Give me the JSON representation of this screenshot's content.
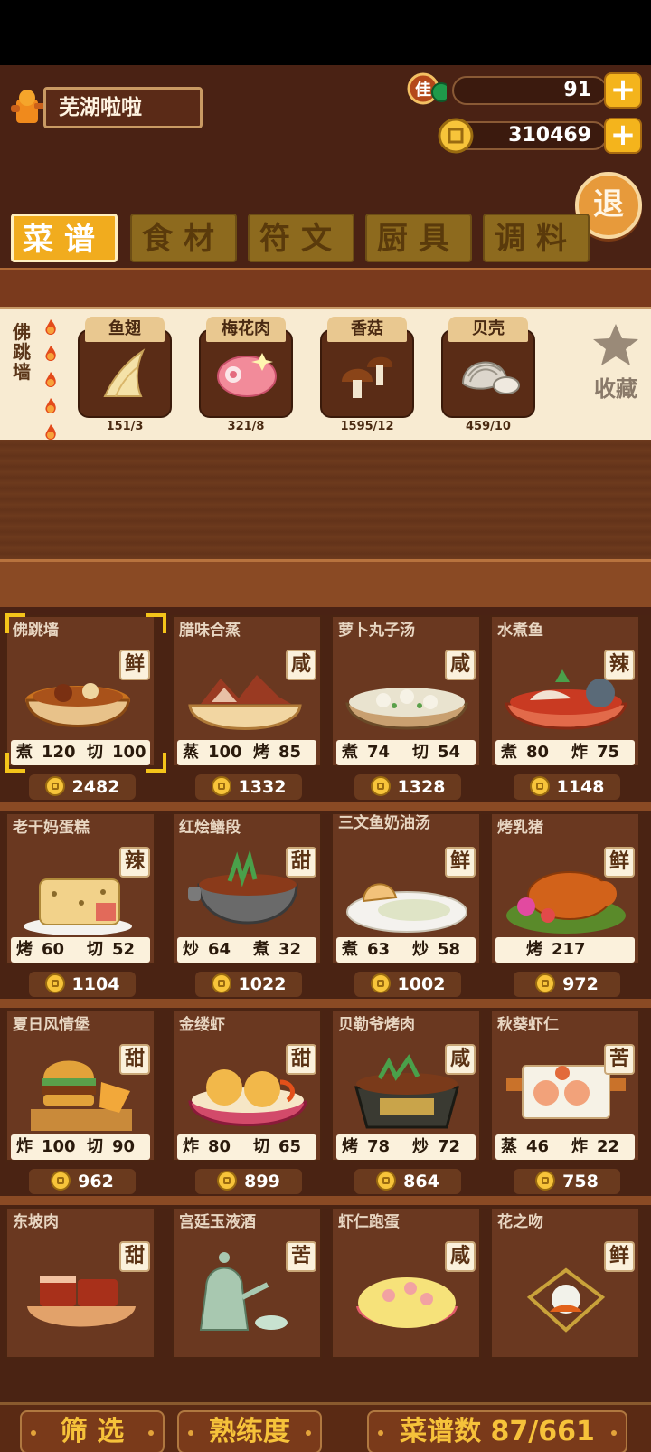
{
  "player": {
    "name": "芜湖啦啦"
  },
  "currencies": [
    {
      "icon": "jade-icon",
      "badge": "佳",
      "value": "91"
    },
    {
      "icon": "coin-icon",
      "value": "310469"
    }
  ],
  "exit_label": "退",
  "tabs": [
    {
      "label": "菜谱",
      "active": true
    },
    {
      "label": "食材",
      "active": false
    },
    {
      "label": "符文",
      "active": false
    },
    {
      "label": "厨具",
      "active": false
    },
    {
      "label": "调料",
      "active": false
    }
  ],
  "selected_recipe": {
    "name": "佛跳墙",
    "stars": 5,
    "ingredients": [
      {
        "name": "鱼翅",
        "count": "151/3"
      },
      {
        "name": "梅花肉",
        "count": "321/8"
      },
      {
        "name": "香菇",
        "count": "1595/12"
      },
      {
        "name": "贝壳",
        "count": "459/10"
      }
    ],
    "favorite_label": "收藏"
  },
  "recipes": [
    {
      "name": "佛跳墙",
      "flavor": "鲜",
      "s1": "煮",
      "v1": "120",
      "s2": "切",
      "v2": "100",
      "price": "2482"
    },
    {
      "name": "腊味合蒸",
      "flavor": "咸",
      "s1": "蒸",
      "v1": "100",
      "s2": "烤",
      "v2": "85",
      "price": "1332"
    },
    {
      "name": "萝卜丸子汤",
      "flavor": "咸",
      "s1": "煮",
      "v1": "74",
      "s2": "切",
      "v2": "54",
      "price": "1328"
    },
    {
      "name": "水煮鱼",
      "flavor": "辣",
      "s1": "煮",
      "v1": "80",
      "s2": "炸",
      "v2": "75",
      "price": "1148"
    },
    {
      "name": "老干妈蛋糕",
      "flavor": "辣",
      "s1": "烤",
      "v1": "60",
      "s2": "切",
      "v2": "52",
      "price": "1104"
    },
    {
      "name": "红烩鳝段",
      "flavor": "甜",
      "s1": "炒",
      "v1": "64",
      "s2": "煮",
      "v2": "32",
      "price": "1022"
    },
    {
      "name": "三文鱼奶油汤",
      "flavor": "鲜",
      "s1": "煮",
      "v1": "63",
      "s2": "炒",
      "v2": "58",
      "price": "1002"
    },
    {
      "name": "烤乳猪",
      "flavor": "鲜",
      "s1": "烤",
      "v1": "217",
      "s2": "",
      "v2": "",
      "price": "972"
    },
    {
      "name": "夏日风情堡",
      "flavor": "甜",
      "s1": "炸",
      "v1": "100",
      "s2": "切",
      "v2": "90",
      "price": "962"
    },
    {
      "name": "金缕虾",
      "flavor": "甜",
      "s1": "炸",
      "v1": "80",
      "s2": "切",
      "v2": "65",
      "price": "899"
    },
    {
      "name": "贝勒爷烤肉",
      "flavor": "咸",
      "s1": "烤",
      "v1": "78",
      "s2": "炒",
      "v2": "72",
      "price": "864"
    },
    {
      "name": "秋葵虾仁",
      "flavor": "苦",
      "s1": "蒸",
      "v1": "46",
      "s2": "炸",
      "v2": "22",
      "price": "758"
    },
    {
      "name": "东坡肉",
      "flavor": "甜"
    },
    {
      "name": "宫廷玉液酒",
      "flavor": "苦"
    },
    {
      "name": "虾仁跑蛋",
      "flavor": "咸"
    },
    {
      "name": "花之吻",
      "flavor": "鲜"
    }
  ],
  "bottom": {
    "filter_label": "筛 选",
    "proficiency_label": "熟练度",
    "recipe_count_label": "菜谱数 87/661"
  },
  "colors": {
    "accent": "#f1ac1e",
    "background": "#4a2214",
    "panel": "#6a3820"
  }
}
